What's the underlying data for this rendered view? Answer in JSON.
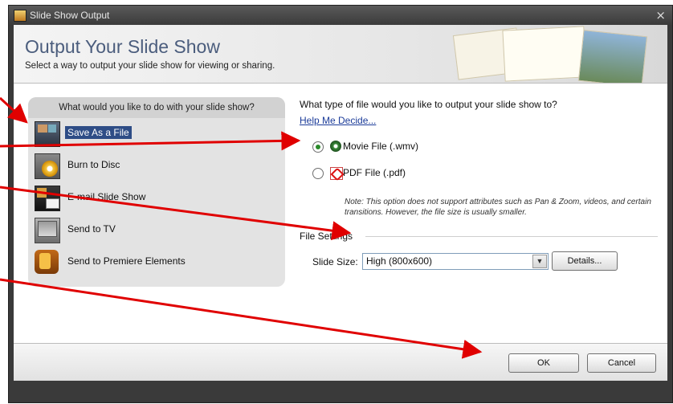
{
  "window": {
    "title": "Slide Show Output",
    "close_glyph": "×"
  },
  "header": {
    "title": "Output Your Slide Show",
    "subtitle": "Select a way to output your slide show for viewing or sharing."
  },
  "left_panel": {
    "heading": "What would you like to do with your slide show?",
    "options": [
      {
        "label": "Save As a File",
        "icon": "save-file-icon",
        "selected": true
      },
      {
        "label": "Burn to Disc",
        "icon": "disc-icon",
        "selected": false
      },
      {
        "label": "E-mail Slide Show",
        "icon": "email-icon",
        "selected": false
      },
      {
        "label": "Send to TV",
        "icon": "tv-icon",
        "selected": false
      },
      {
        "label": "Send to Premiere Elements",
        "icon": "premiere-elements-icon",
        "selected": false
      }
    ]
  },
  "right_panel": {
    "question": "What type of file would you like to output your slide show to?",
    "help_link": "Help Me Decide...",
    "file_types": [
      {
        "label": "Movie File (.wmv)",
        "selected": true,
        "icon": "movie-file-icon"
      },
      {
        "label": "PDF File (.pdf)",
        "selected": false,
        "icon": "pdf-icon"
      }
    ],
    "note": "Note: This option does not support attributes such as Pan & Zoom, videos, and certain transitions. However, the file size is usually smaller.",
    "file_settings_label": "File Settings",
    "slide_size_label": "Slide Size:",
    "slide_size_value": "High (800x600)",
    "details_button": "Details..."
  },
  "footer": {
    "ok_label": "OK",
    "cancel_label": "Cancel"
  },
  "colors": {
    "annotation_arrow": "#e00000",
    "selection": "#2e4d86",
    "title_text": "#4b5d7d"
  }
}
